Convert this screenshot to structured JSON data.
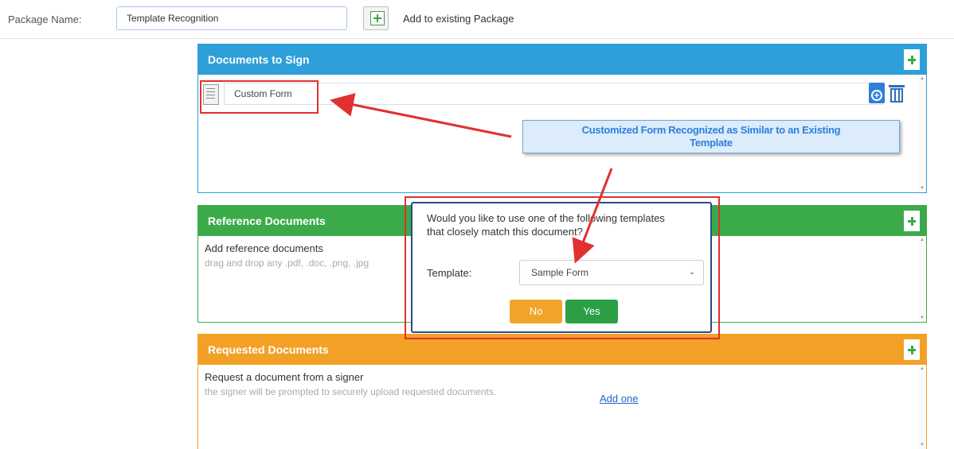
{
  "header": {
    "package_label": "Package Name:",
    "package_value": "Template Recognition",
    "add_existing_label": "Add to existing Package"
  },
  "documents_to_sign": {
    "title": "Documents to Sign",
    "items": [
      {
        "name": "Custom Form"
      }
    ]
  },
  "reference_documents": {
    "title": "Reference Documents",
    "line1": "Add reference documents",
    "line2": "drag and drop any .pdf, .doc, .png, .jpg"
  },
  "requested_documents": {
    "title": "Requested Documents",
    "line1": "Request a document from a signer",
    "line2": "the signer will be prompted to securely upload requested documents.",
    "add_link": "Add one"
  },
  "callout": {
    "line1": "Customized Form Recognized as Similar to an Existing",
    "line2": "Template"
  },
  "dialog": {
    "question": "Would you like to use one of the following templates that closely match this document?",
    "template_label": "Template:",
    "template_selected": "Sample Form",
    "no_label": "No",
    "yes_label": "Yes"
  },
  "colors": {
    "sign_header": "#2e9fd8",
    "reference_header": "#3bab49",
    "requested_header": "#f2a126",
    "annotation_red": "#e03030"
  }
}
